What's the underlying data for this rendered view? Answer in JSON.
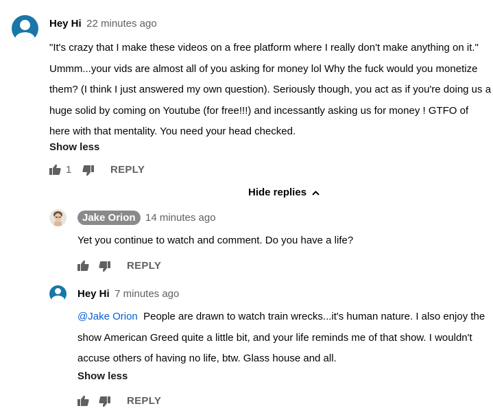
{
  "comment": {
    "author": "Hey Hi",
    "time": "22 minutes ago",
    "lines": [
      "\"It's crazy that I make these videos on a free platform where I really don't make anything on it.\"",
      "Ummm...your vids are almost all of you asking for money lol Why the fuck would you monetize",
      "them? (I think I just answered my own question). Seriously though, you act as if you're doing us a",
      "huge solid by coming on Youtube (for free!!!) and incessantly asking us for money ! GTFO of",
      "here with that mentality. You need your head checked."
    ],
    "show_less": "Show less",
    "like_count": "1",
    "reply_label": "REPLY"
  },
  "hide_replies": "Hide replies",
  "replies": [
    {
      "author": "Jake Orion",
      "time": "14 minutes ago",
      "text": "Yet you continue to watch and comment. Do you have a life?",
      "reply_label": "REPLY"
    },
    {
      "author": "Hey Hi",
      "time": "7 minutes ago",
      "mention": "@Jake Orion",
      "lines": [
        "People are drawn to watch train wrecks...it's human nature.  I also enjoy the",
        "show American Greed quite a little bit, and your life reminds me of that show.  I wouldn't",
        "accuse others of having no life, btw.  Glass house and all."
      ],
      "show_less": "Show less",
      "reply_label": "REPLY"
    }
  ],
  "colors": {
    "avatar": "#1976a8",
    "mention": "#065fd4",
    "secondary_text": "#606060",
    "badge": "#8a8a8a"
  },
  "icons": [
    "person-avatar-icon",
    "thumb-up-icon",
    "thumb-down-icon",
    "chevron-up-icon"
  ]
}
